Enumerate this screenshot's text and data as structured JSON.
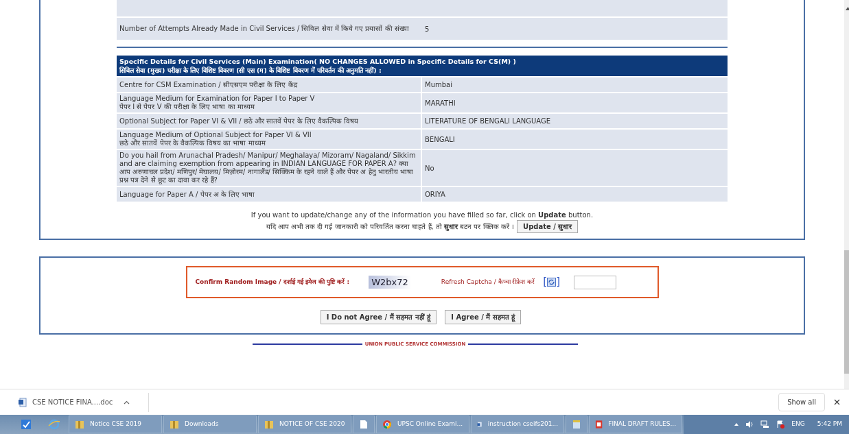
{
  "attempts_row": {
    "label": "Number of Attempts Already Made in Civil Services / सिविल सेवा में किये गए प्रयासों की संख्या",
    "value": "5"
  },
  "section": {
    "title": "Specific Details for Civil Services (Main) Examination( NO CHANGES ALLOWED in Specific Details for CS(M) )",
    "title_hindi": "सिविल सेवा (मुख्य) परीक्षा के लिए विशिष्ट विवरण (सी एस (म) के विशिष्ट विवरण में परिवर्तन की अनुमति नहीं) :",
    "rows": [
      {
        "label": [
          "Centre for CSM Examination / सीएसएम परीक्षा के लिए केंद्र"
        ],
        "value": "Mumbai"
      },
      {
        "label": [
          "Language Medium for Examination for Paper I to Paper V",
          "पेपर I से पेपर V की परीक्षा के लिए भाषा का माध्यम"
        ],
        "value": "MARATHI"
      },
      {
        "label": [
          "Optional Subject for Paper VI & VII / छठे और सातवें पेपर के लिए वैकल्पिक विषय"
        ],
        "value": "LITERATURE OF BENGALI LANGUAGE"
      },
      {
        "label": [
          "Language Medium of Optional Subject for Paper VI & VII",
          "छठे और सातवें पेपर के वैकल्पिक विषय का भाषा माध्यम"
        ],
        "value": "BENGALI"
      },
      {
        "label": [
          "Do you hail from Arunachal Pradesh/ Manipur/ Meghalaya/ Mizoram/ Nagaland/ Sikkim and are claiming exemption from appearing in INDIAN LANGUAGE FOR PAPER A? क्या आप अरुणाचल प्रदेश/ मणिपुर/ मेघालय/ मिज़ोरम/ नागालैंड/ सिक्किम के रहने वाले हैं और पेपर अ हेतु भारतीय भाषा प्रश्न पत्र देने से छूट का दावा कर रहे हैं?"
        ],
        "value": "No"
      },
      {
        "label": [
          "Language for Paper A / पेपर अ के लिए भाषा"
        ],
        "value": "ORIYA"
      }
    ]
  },
  "update": {
    "note": "If you want to update/change any of the information you have filled so far, click on **Update** button.",
    "note_hindi": "यदि आप अभी तक दी गई जानकारी को परिवर्तित करना चाहते हैं, तो **सुधार** बटन पर क्लिक करें ।",
    "button": "Update / सुधार"
  },
  "captcha": {
    "label": "Confirm Random Image / दर्शाई गई इमेज की पुष्टि करें :",
    "code": "W2bx72",
    "refresh_label": "Refresh Captcha / कैप्चा रीफ्रेश करें",
    "bracket_open": "[",
    "bracket_close": "]"
  },
  "buttons": [
    "I Do not Agree / मैं सहमत नहीं हूं",
    "I Agree / मैं सहमत हूं"
  ],
  "footer": "UNION PUBLIC SERVICE COMMISSION",
  "download_bar": {
    "file": "CSE NOTICE FINA....doc",
    "show_all": "Show all"
  },
  "taskbar": {
    "items": [
      {
        "kind": "folder",
        "label": "Notice CSE 2019"
      },
      {
        "kind": "folder",
        "label": "Downloads"
      },
      {
        "kind": "folder",
        "label": "NOTICE OF CSE 2020"
      },
      {
        "kind": "file"
      },
      {
        "kind": "browser",
        "label": "UPSC Online Exami..."
      },
      {
        "kind": "doc",
        "label": "instruction cseifs201..."
      },
      {
        "kind": "note"
      },
      {
        "kind": "pdf",
        "label": "FINAL DRAFT RULES..."
      }
    ],
    "language": "ENG",
    "time": "5:42 PM"
  }
}
